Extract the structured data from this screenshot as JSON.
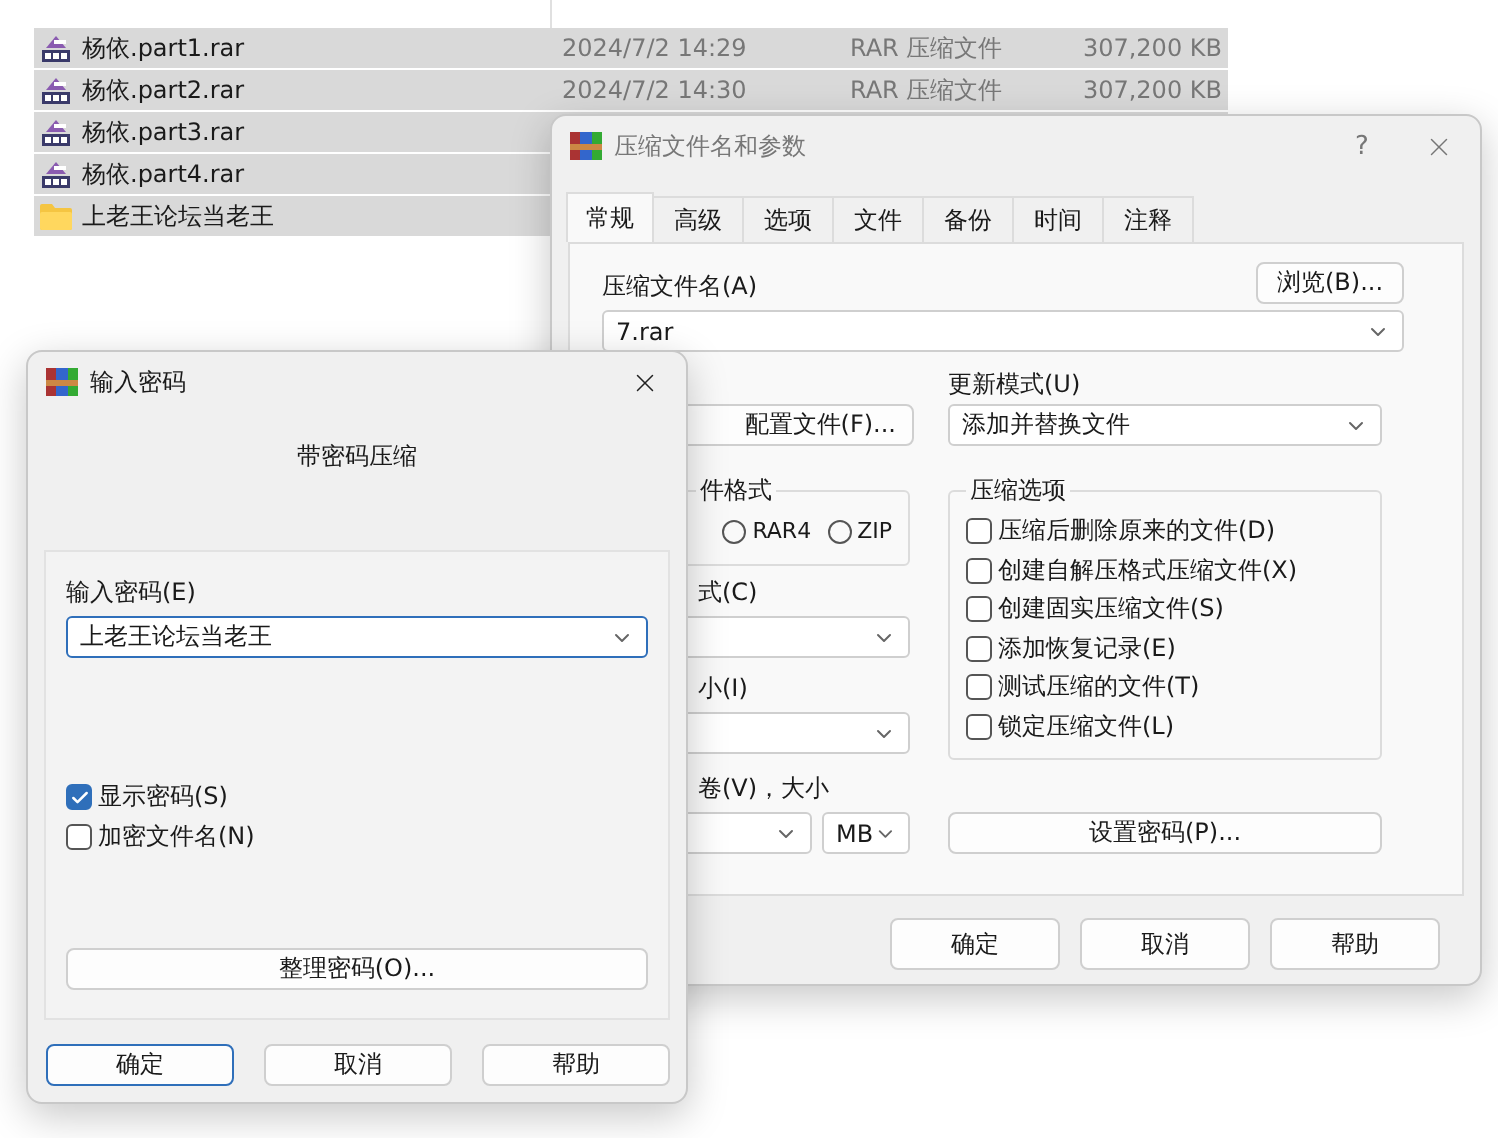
{
  "file_list": {
    "rows": [
      {
        "kind": "archive",
        "name": "杨依.part1.rar",
        "date": "2024/7/2 14:29",
        "type": "RAR 压缩文件",
        "size": "307,200 KB",
        "selected": true
      },
      {
        "kind": "archive",
        "name": "杨依.part2.rar",
        "date": "2024/7/2 14:30",
        "type": "RAR 压缩文件",
        "size": "307,200 KB",
        "selected": true
      },
      {
        "kind": "archive",
        "name": "杨依.part3.rar",
        "selected": true
      },
      {
        "kind": "archive",
        "name": "杨依.part4.rar",
        "selected": true
      },
      {
        "kind": "folder",
        "name": "上老王论坛当老王",
        "selected": true
      }
    ]
  },
  "archive_dialog": {
    "title": "压缩文件名和参数",
    "help": "?",
    "tabs": [
      {
        "label": "常规",
        "selected": true
      },
      {
        "label": "高级",
        "selected": false
      },
      {
        "label": "选项",
        "selected": false
      },
      {
        "label": "文件",
        "selected": false
      },
      {
        "label": "备份",
        "selected": false
      },
      {
        "label": "时间",
        "selected": false
      },
      {
        "label": "注释",
        "selected": false
      }
    ],
    "archive_name_label": "压缩文件名(A)",
    "browse_button": "浏览(B)...",
    "archive_name": "7.rar",
    "profiles_button": "配置文件(F)...",
    "update_mode_label": "更新模式(U)",
    "update_mode": "添加并替换文件",
    "format_group": {
      "label": "件格式",
      "radios": [
        {
          "label": "RAR4",
          "selected": false
        },
        {
          "label": "ZIP",
          "selected": false
        }
      ]
    },
    "method_label": "式(C)",
    "dictionary_label": "小(I)",
    "volume_label": "卷(V)，大小",
    "volume_unit": "MB",
    "options_group": {
      "label": "压缩选项",
      "checkboxes": [
        {
          "label": "压缩后删除原来的文件(D)",
          "checked": false
        },
        {
          "label": "创建自解压格式压缩文件(X)",
          "checked": false
        },
        {
          "label": "创建固实压缩文件(S)",
          "checked": false
        },
        {
          "label": "添加恢复记录(E)",
          "checked": false
        },
        {
          "label": "测试压缩的文件(T)",
          "checked": false
        },
        {
          "label": "锁定压缩文件(L)",
          "checked": false
        }
      ]
    },
    "set_password_button": "设置密码(P)...",
    "buttons": [
      {
        "label": "确定",
        "default": false
      },
      {
        "label": "取消",
        "default": false
      },
      {
        "label": "帮助",
        "default": false
      }
    ]
  },
  "password_dialog": {
    "title": "输入密码",
    "heading": "带密码压缩",
    "password_label": "输入密码(E)",
    "password": "上老王论坛当老王",
    "checkboxes": [
      {
        "label": "显示密码(S)",
        "checked": true
      },
      {
        "label": "加密文件名(N)",
        "checked": false
      }
    ],
    "organize_button": "整理密码(O)...",
    "buttons": [
      {
        "label": "确定",
        "default": true
      },
      {
        "label": "取消",
        "default": false
      },
      {
        "label": "帮助",
        "default": false
      }
    ]
  }
}
